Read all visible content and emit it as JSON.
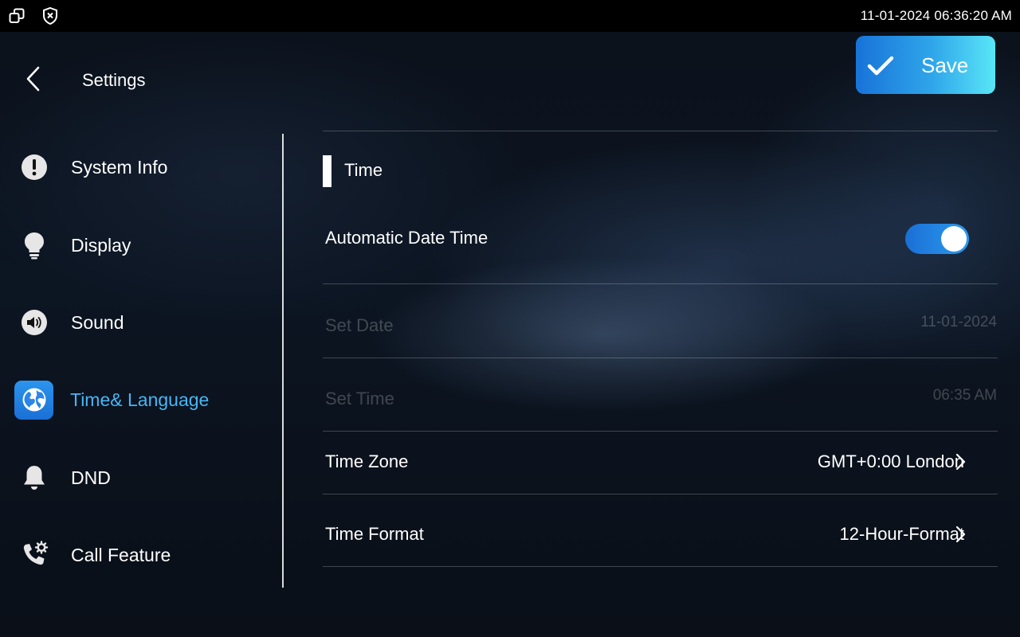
{
  "status_bar": {
    "time": "11-01-2024 06:36:20 AM",
    "icons": [
      "window-switch-icon",
      "shield-icon"
    ]
  },
  "header": {
    "title": "Settings",
    "back_icon": "chevron-left-icon",
    "save_label": "Save",
    "save_icon": "checkmark-icon"
  },
  "colors": {
    "accent": "#47b6f5",
    "button_gradient_start": "#1873d8",
    "button_gradient_end": "#59e6f7",
    "toggle_on": "#1b6fd5"
  },
  "sidebar": {
    "items": [
      {
        "label": "System Info",
        "icon": "info-exclamation-icon",
        "active": false
      },
      {
        "label": "Display",
        "icon": "lightbulb-icon",
        "active": false
      },
      {
        "label": "Sound",
        "icon": "speaker-icon",
        "active": false
      },
      {
        "label": "Time& Language",
        "icon": "globe-icon",
        "active": true
      },
      {
        "label": "DND",
        "icon": "bell-icon",
        "active": false
      },
      {
        "label": "Call Feature",
        "icon": "phone-gear-icon",
        "active": false
      }
    ]
  },
  "content": {
    "section_title": "Time",
    "rows": {
      "auto_datetime": {
        "label": "Automatic Date Time",
        "toggle_on": true
      },
      "set_date": {
        "label": "Set Date",
        "value": "11-01-2024",
        "enabled": false
      },
      "set_time": {
        "label": "Set Time",
        "value": "06:35 AM",
        "enabled": false
      },
      "time_zone": {
        "label": "Time Zone",
        "value": "GMT+0:00 London"
      },
      "time_format": {
        "label": "Time Format",
        "value": "12-Hour-Format"
      }
    }
  }
}
